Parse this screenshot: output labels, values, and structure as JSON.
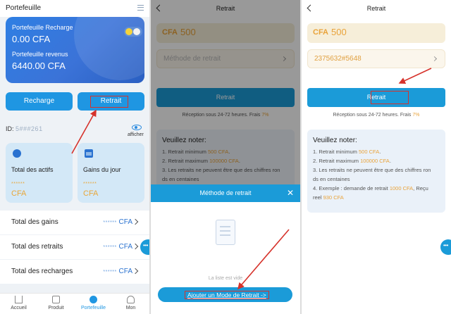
{
  "panel1": {
    "header_title": "Portefeuille",
    "wallet": {
      "recharge_label": "Portefeuille Recharge",
      "recharge_value": "0.00 CFA",
      "revenus_label": "Portefeuille revenus",
      "revenus_value": "6440.00 CFA"
    },
    "buttons": {
      "recharge": "Recharge",
      "retrait": "Retrait"
    },
    "id_label": "ID:",
    "id_value": "5###261",
    "afficher": "afficher",
    "cards": [
      {
        "title": "Total des actifs",
        "stars": "******",
        "cfa": "CFA"
      },
      {
        "title": "Gains du jour",
        "stars": "******",
        "cfa": "CFA"
      }
    ],
    "rows": [
      {
        "label": "Total des gains",
        "dots": "******",
        "cfa": "CFA"
      },
      {
        "label": "Total des retraits",
        "dots": "******",
        "cfa": "CFA"
      },
      {
        "label": "Total des recharges",
        "dots": "******",
        "cfa": "CFA"
      }
    ],
    "tabs": [
      {
        "label": "Accueil",
        "icon": "home-icon"
      },
      {
        "label": "Produit",
        "icon": "box-icon"
      },
      {
        "label": "Portefeuille",
        "icon": "wallet-icon"
      },
      {
        "label": "Mon",
        "icon": "user-icon"
      }
    ],
    "accent": "#1f96e2"
  },
  "panel2": {
    "title": "Retrait",
    "amount_prefix": "CFA",
    "amount_value": "500",
    "method_placeholder": "Méthode de retrait",
    "button": "Retrait",
    "reception": "Réception sous 24-72 heures.",
    "frais_label": "Frais",
    "frais_pct": "7%",
    "note_title": "Veuillez noter:",
    "note_lines": [
      {
        "pre": "1. Retrait minimum ",
        "hl": "500 CFA",
        "post": "."
      },
      {
        "pre": "2. Retrait maximum ",
        "hl": "100000 CFA",
        "post": "."
      },
      {
        "pre": "3. Les retraits ne peuvent être que des chiffres ron",
        "hl": "",
        "post": ""
      },
      {
        "pre": "ds en centaines",
        "hl": "",
        "post": ""
      }
    ],
    "sheet_title": "Méthode de retrait",
    "empty_text": "La liste est vide",
    "add_button": "Ajouter un Mode de Retrait ->"
  },
  "panel3": {
    "title": "Retrait",
    "amount_prefix": "CFA",
    "amount_value": "500",
    "method_value": "2375632#5648",
    "button": "Retrait",
    "reception": "Réception sous 24-72 heures.",
    "frais_label": "Frais",
    "frais_pct": "7%",
    "note_title": "Veuillez noter:",
    "note_lines": [
      {
        "pre": "1. Retrait minimum ",
        "hl": "500 CFA",
        "post": "."
      },
      {
        "pre": "2. Retrait maximum ",
        "hl": "100000 CFA",
        "post": "."
      },
      {
        "pre": "3. Les retraits ne peuvent être que des chiffres ron",
        "hl": "",
        "post": ""
      },
      {
        "pre": "ds en centaines",
        "hl": "",
        "post": ""
      },
      {
        "pre": "4. Exemple : demande de retrait ",
        "hl": "1000 CFA",
        "post": ",    Reçu"
      },
      {
        "pre": "reel ",
        "hl": "930 CFA",
        "post": ""
      }
    ]
  },
  "colors": {
    "highlight": "#e9a33a",
    "annotation_red": "#d6322b",
    "button_blue": "#1b9bd8"
  }
}
